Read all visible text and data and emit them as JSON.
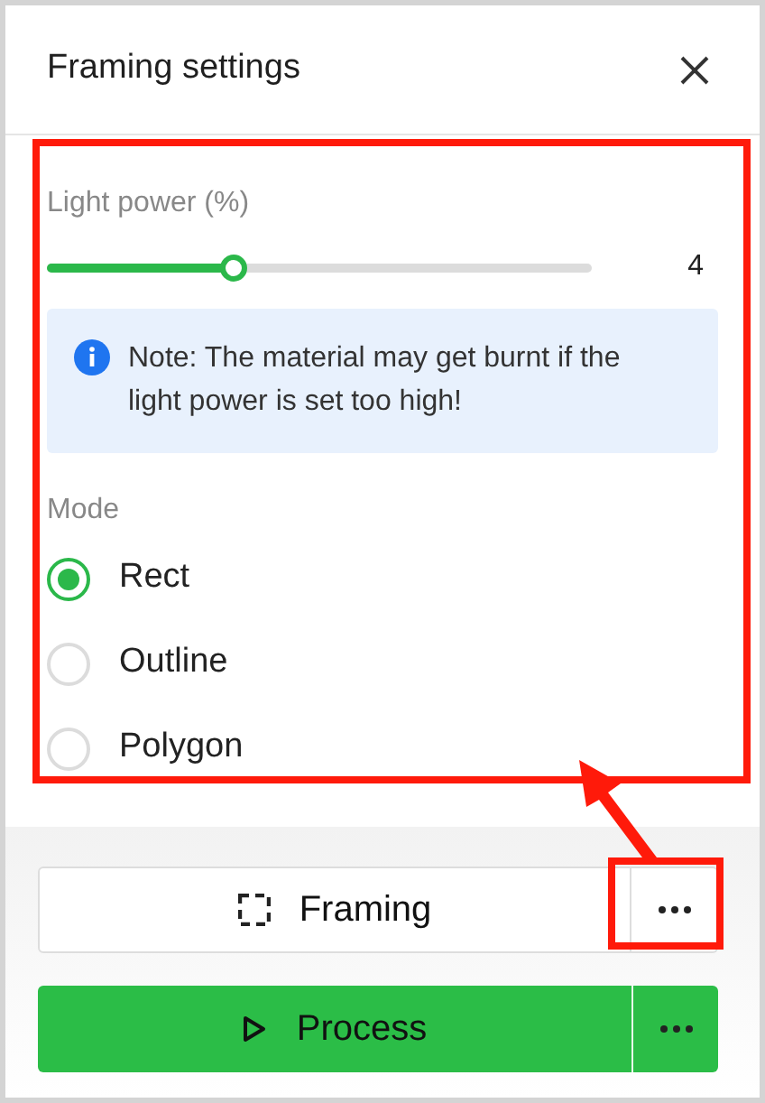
{
  "panel": {
    "title": "Framing settings"
  },
  "light_power": {
    "label": "Light power (%)",
    "level": 0.34,
    "reading": "4"
  },
  "note": {
    "text": "Note: The material may get burnt if the light power is set too high!"
  },
  "mode": {
    "label": "Mode",
    "options": [
      {
        "label": "Rect",
        "selected": true
      },
      {
        "label": "Outline",
        "selected": false
      },
      {
        "label": "Polygon",
        "selected": false
      }
    ]
  },
  "buttons": [
    {
      "kind": "outline",
      "label": "Framing"
    },
    {
      "kind": "primary",
      "label": "Process"
    }
  ]
}
